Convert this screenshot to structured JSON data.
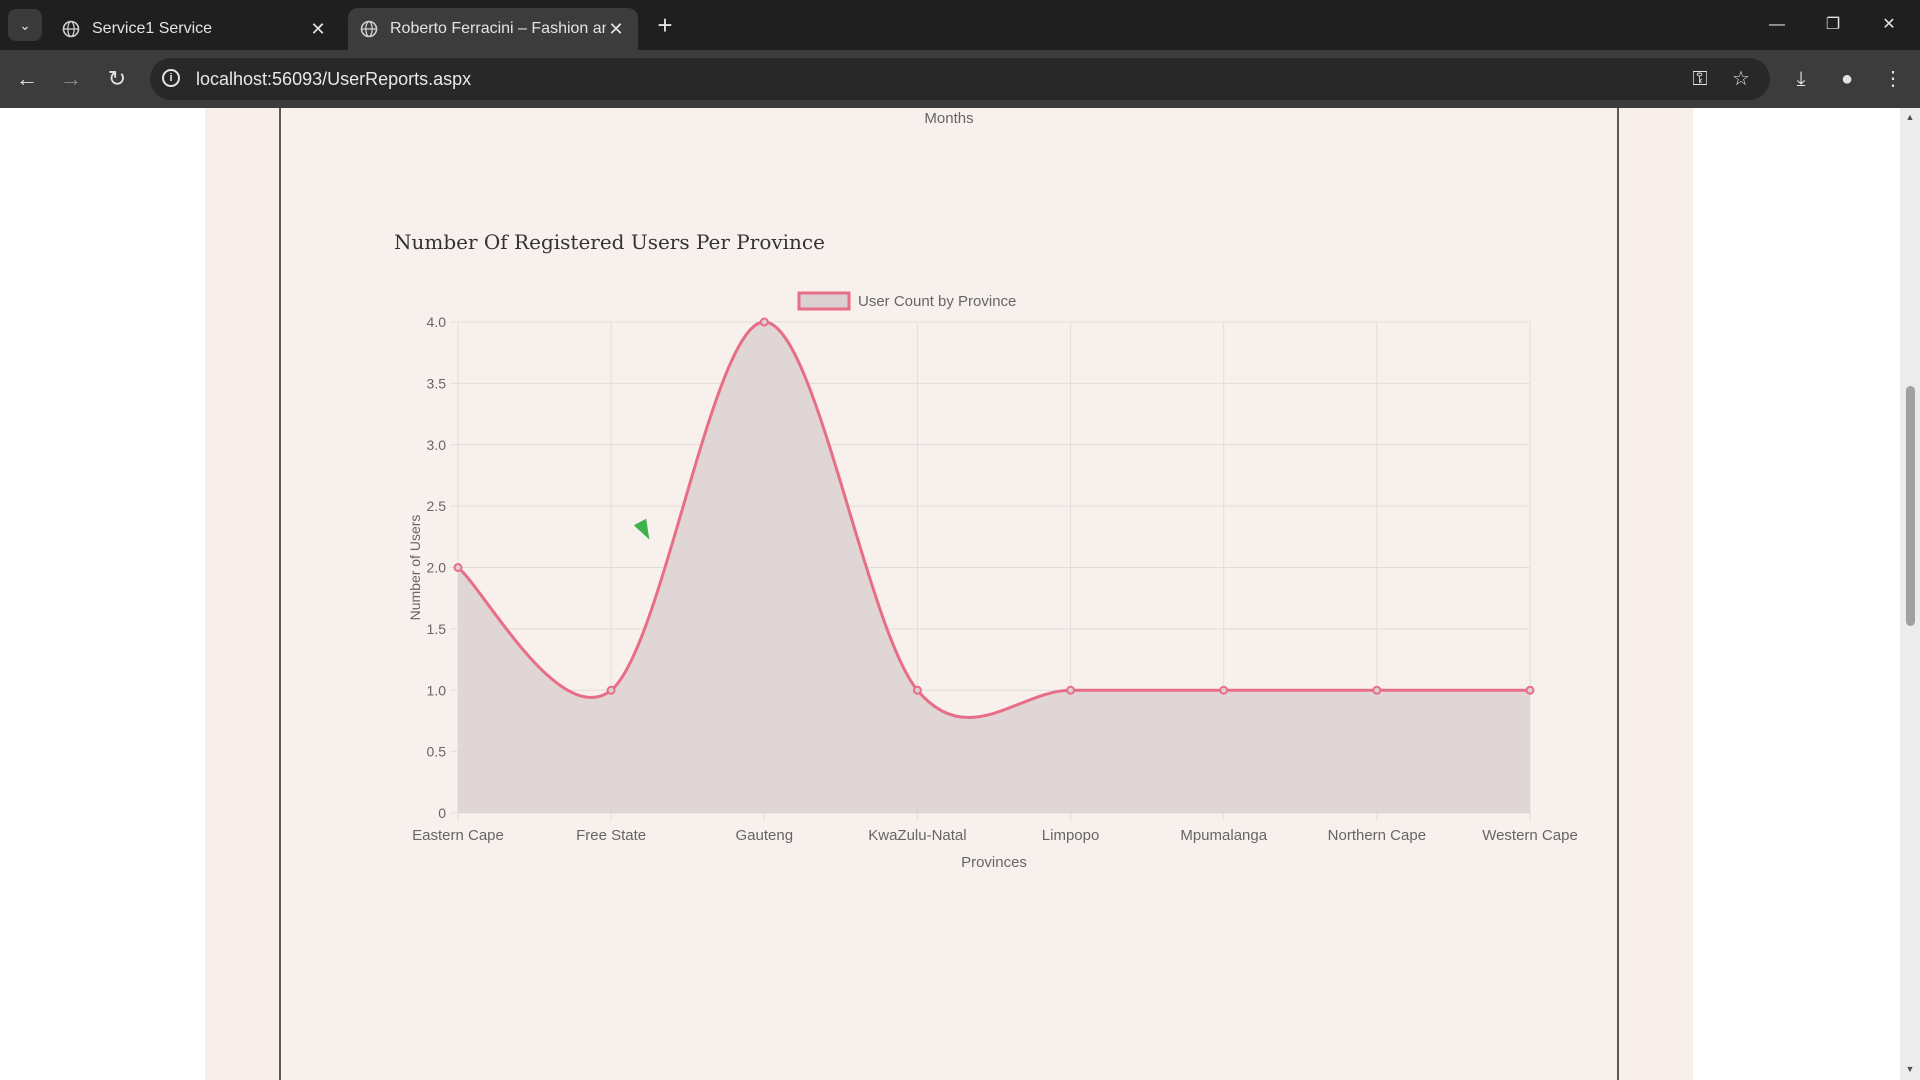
{
  "browser": {
    "tabs": [
      {
        "title": "Service1 Service",
        "active": false
      },
      {
        "title": "Roberto Ferracini – Fashion and",
        "active": true
      }
    ],
    "url": "localhost:56093/UserReports.aspx"
  },
  "page": {
    "previous_chart_axis_label": "Months",
    "chart_heading": "Number Of Registered Users Per Province"
  },
  "chart_data": {
    "type": "line",
    "title": "Number Of Registered Users Per Province",
    "categories": [
      "Eastern Cape",
      "Free State",
      "Gauteng",
      "KwaZulu-Natal",
      "Limpopo",
      "Mpumalanga",
      "Northern Cape",
      "Western Cape"
    ],
    "series": [
      {
        "name": "User Count by Province",
        "values": [
          2,
          1,
          4,
          1,
          1,
          1,
          1,
          1
        ]
      }
    ],
    "xlabel": "Provinces",
    "ylabel": "Number of Users",
    "ylim": [
      0,
      4
    ],
    "yticks": [
      "0",
      "0.5",
      "1.0",
      "1.5",
      "2.0",
      "2.5",
      "3.0",
      "3.5",
      "4.0"
    ],
    "grid": true,
    "filled": true,
    "legend_position": "top",
    "colors": {
      "line": "#e76e86",
      "fill": "#dcd1d1"
    }
  }
}
